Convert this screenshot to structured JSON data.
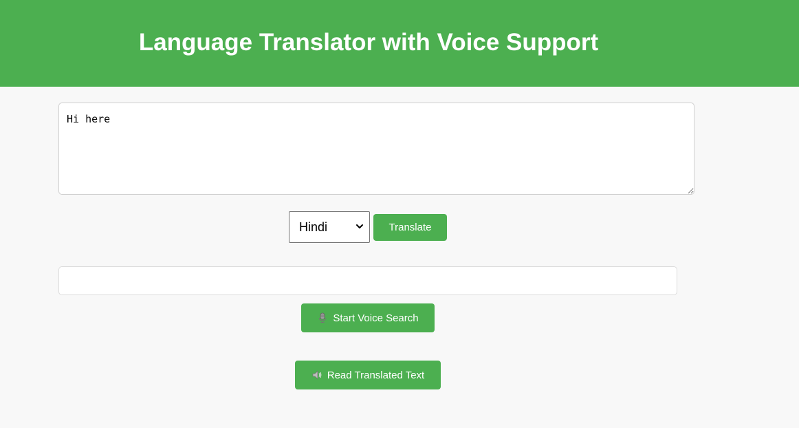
{
  "header": {
    "title": "Language Translator with Voice Support"
  },
  "source": {
    "value": "Hi here",
    "placeholder": ""
  },
  "language": {
    "selected": "Hindi"
  },
  "buttons": {
    "translate": "Translate",
    "voice_search": "Start Voice Search",
    "read_text": "Read Translated Text"
  },
  "output": {
    "value": "",
    "placeholder": ""
  },
  "icons": {
    "voice_search": "microphone-icon",
    "read_text": "speaker-icon"
  },
  "colors": {
    "accent": "#4caf50",
    "background": "#f8f8f8",
    "white": "#ffffff"
  }
}
